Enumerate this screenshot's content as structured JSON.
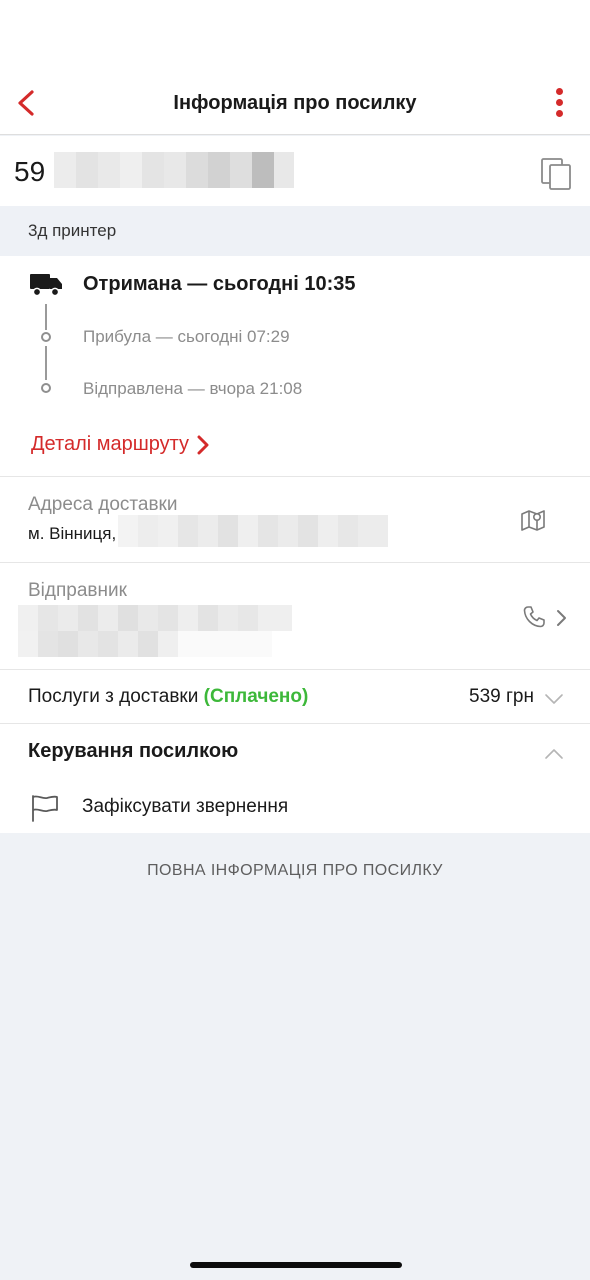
{
  "header": {
    "title": "Інформація про посилку"
  },
  "parcel": {
    "tracking_prefix": "59",
    "description": "3д принтер"
  },
  "status": {
    "current": "Отримана — сьогодні 10:35",
    "history": [
      "Прибула — сьогодні 07:29",
      "Відправлена — вчора 21:08"
    ],
    "route_link": "Деталі маршруту"
  },
  "delivery_address": {
    "label": "Адреса доставки",
    "value": "м. Вінниця,"
  },
  "sender": {
    "label": "Відправник"
  },
  "services": {
    "label": "Послуги з доставки",
    "status": "(Сплачено)",
    "price": "539 грн"
  },
  "management": {
    "title": "Керування посилкою",
    "actions": [
      {
        "label": "Зафіксувати звернення",
        "icon": "flag-icon"
      }
    ]
  },
  "footer": {
    "full_info_link": "ПОВНА ІНФОРМАЦІЯ ПРО ПОСИЛКУ"
  },
  "colors": {
    "accent": "#d42a2a",
    "paid": "#3db83a",
    "background": "#eff2f6"
  }
}
